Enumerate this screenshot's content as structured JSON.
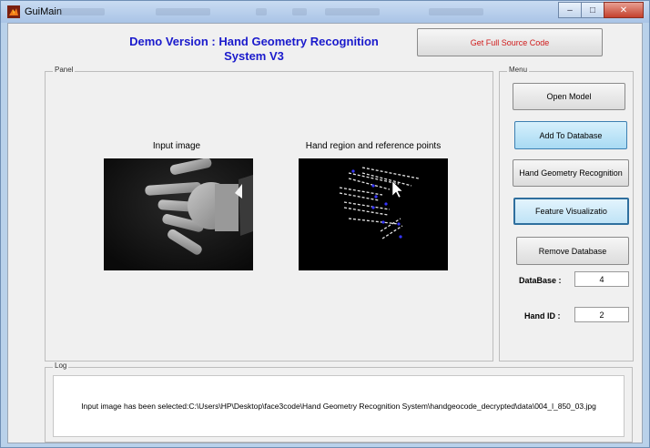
{
  "window": {
    "title": "GuiMain",
    "minimize": "–",
    "maximize": "□",
    "close": "✕"
  },
  "header": {
    "title_line1": "Demo Version : Hand Geometry Recognition",
    "title_line2": "System V3",
    "full_source_button": "Get Full Source Code"
  },
  "panel": {
    "legend": "Panel",
    "input_caption": "Input image",
    "hand_caption": "Hand region and reference points"
  },
  "menu": {
    "legend": "Menu",
    "buttons": {
      "open_model": "Open Model",
      "add_to_database": "Add To Database",
      "hand_geometry_recognition": "Hand Geometry Recognition",
      "feature_visualization": "Feature Visualizatio",
      "remove_database": "Remove Database"
    },
    "database_label": "DataBase :",
    "database_value": "4",
    "hand_id_label": "Hand ID :",
    "hand_id_value": "2"
  },
  "log": {
    "legend": "Log",
    "message": "Input image has been selected:C:\\Users\\HP\\Desktop\\face3code\\Hand Geometry Recognition System\\handgeocode_decrypted\\data\\004_l_850_03.jpg"
  },
  "colors": {
    "title_blue": "#1a1acc",
    "source_red": "#d01a1a",
    "highlight_blue": "#a8daf3"
  },
  "icons": {
    "app": "matlab-icon"
  }
}
